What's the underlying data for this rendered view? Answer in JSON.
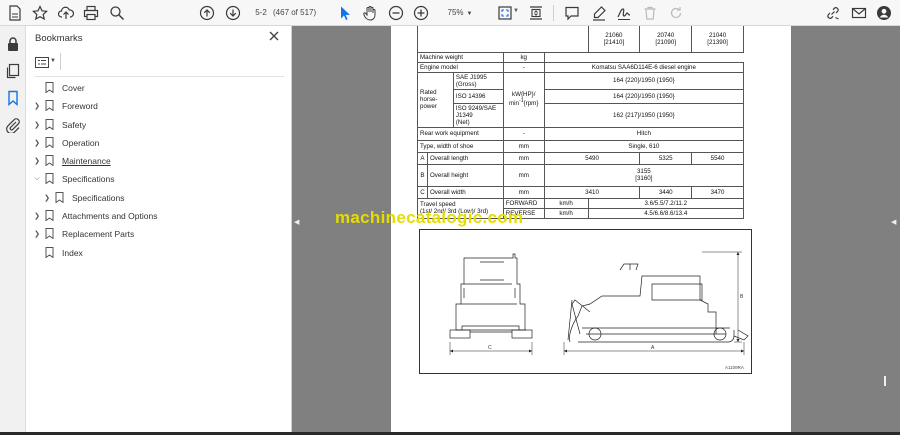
{
  "toolbar": {
    "page_input": "5-2",
    "page_count": "(467 of 517)",
    "zoom": "75%"
  },
  "bookmarks": {
    "title": "Bookmarks",
    "items": [
      {
        "label": "Cover",
        "expandable": false,
        "indent": 0
      },
      {
        "label": "Foreword",
        "expandable": true,
        "indent": 0
      },
      {
        "label": "Safety",
        "expandable": true,
        "indent": 0
      },
      {
        "label": "Operation",
        "expandable": true,
        "indent": 0
      },
      {
        "label": "Maintenance",
        "expandable": true,
        "indent": 0
      },
      {
        "label": "Specifications",
        "expandable": true,
        "expanded": true,
        "indent": 0
      },
      {
        "label": "Specifications",
        "expandable": true,
        "indent": 1
      },
      {
        "label": "Attachments and Options",
        "expandable": true,
        "indent": 0
      },
      {
        "label": "Replacement Parts",
        "expandable": true,
        "indent": 0
      },
      {
        "label": "Index",
        "expandable": false,
        "indent": 0
      }
    ]
  },
  "spec_table": {
    "top_row": {
      "c1": "21060",
      "c1b": "[21410]",
      "c2": "20740",
      "c2b": "[21090]",
      "c3": "21040",
      "c3b": "[21390]"
    },
    "machine_weight": {
      "label": "Machine weight",
      "unit": "kg"
    },
    "engine_model": {
      "label": "Engine model",
      "unit": "-",
      "value": "Komatsu SAA6D114E-6 diesel engine"
    },
    "rated_hp": {
      "label_1": "Rated",
      "label_2": "horse-",
      "label_3": "power",
      "unit_1": "kW{HP}/",
      "unit_2": "min",
      "unit_3": "{rpm}",
      "unit_sup": "-1",
      "rows": [
        {
          "std": "SAE J1995",
          "std2": "(Gross)",
          "value": "164 {220}/1950 {1950}"
        },
        {
          "std": "ISO 14396",
          "std2": "",
          "value": "164 {220}/1950 {1950}"
        },
        {
          "std": "ISO 9249/SAE J1349",
          "std2": "(Net)",
          "value": "162 {217}/1950 {1950}"
        }
      ]
    },
    "rear_work": {
      "label": "Rear work equipment",
      "unit": "-",
      "value": "Hitch"
    },
    "shoe": {
      "label": "Type, width of shoe",
      "unit": "mm",
      "value": "Single, 610"
    },
    "overall_length": {
      "letter": "A",
      "label": "Overall length",
      "unit": "mm",
      "v1": "5490",
      "v2": "5325",
      "v3": "5540"
    },
    "overall_height": {
      "letter": "B",
      "label": "Overall height",
      "unit": "mm",
      "v": "3155",
      "v2": "[3160]"
    },
    "overall_width": {
      "letter": "C",
      "label": "Overall width",
      "unit": "mm",
      "v1": "3410",
      "v2": "3440",
      "v3": "3470"
    },
    "travel": {
      "label_1": "Travel speed",
      "label_2": "(1st/ 2nd/ 3rd (Low)/ 3rd)",
      "forward": "FORWARD",
      "reverse": "REVERSE",
      "unit": "km/h",
      "forward_value": "3.6/5.5/7.2/11.2",
      "reverse_value": "4.5/6.6/8.6/13.4"
    }
  },
  "watermark": "machinecatalogic.com",
  "figure": {
    "dim_a": "A",
    "dim_b": "B",
    "dim_c": "C",
    "id": "A1109RA"
  }
}
